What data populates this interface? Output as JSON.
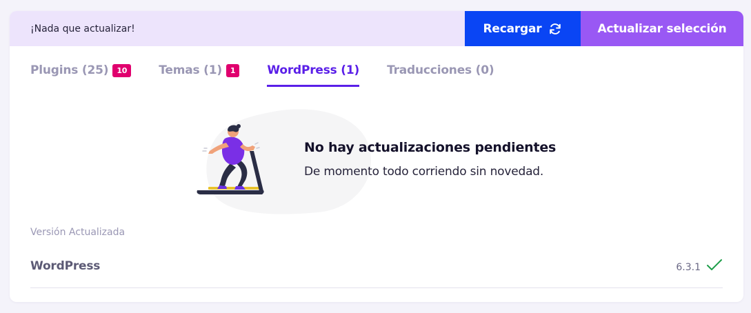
{
  "topbar": {
    "status_message": "¡Nada que actualizar!",
    "reload_label": "Recargar",
    "update_selection_label": "Actualizar selección"
  },
  "tabs": [
    {
      "label": "Plugins (25)",
      "badge": "10",
      "active": false
    },
    {
      "label": "Temas (1)",
      "badge": "1",
      "active": false
    },
    {
      "label": "WordPress (1)",
      "badge": "",
      "active": true
    },
    {
      "label": "Traducciones (0)",
      "badge": "",
      "active": false
    }
  ],
  "empty_state": {
    "title": "No hay actualizaciones pendientes",
    "subtitle": "De momento todo corriendo sin novedad."
  },
  "section": {
    "label": "Versión Actualizada",
    "rows": [
      {
        "name": "WordPress",
        "version": "6.3.1",
        "status_icon": "check-icon"
      }
    ]
  },
  "colors": {
    "reload_button": "#0a45f4",
    "update_button": "#9958f4",
    "active_tab": "#5a1fe8",
    "badge": "#e0006e",
    "check": "#1e9e4a",
    "banner": "#ede4fc"
  },
  "icons": {
    "reload": "refresh-icon",
    "illustration": "treadmill-runner-illustration"
  }
}
